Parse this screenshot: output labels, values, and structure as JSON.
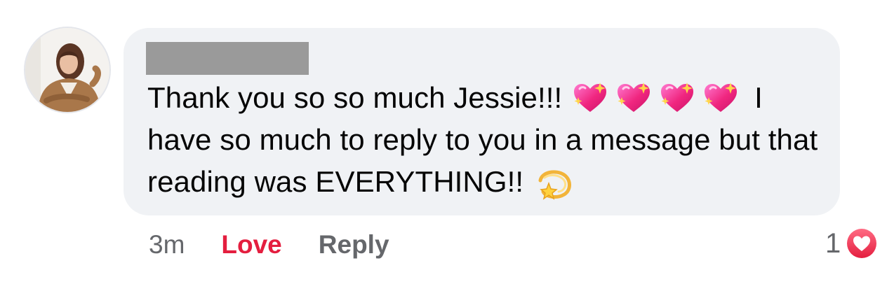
{
  "comment": {
    "text_line1": "Thank you so so much Jessie!!!",
    "text_line1_end": "I",
    "text_rest": "have so much to reply to you in a message but that reading was EVERYTHING!!",
    "emojis": [
      "sparkling-heart",
      "sparkling-heart",
      "sparkling-heart",
      "sparkling-heart",
      "dizzy"
    ]
  },
  "actions": {
    "timestamp": "3m",
    "love_label": "Love",
    "reply_label": "Reply"
  },
  "reactions": {
    "count": "1",
    "type": "love"
  },
  "colors": {
    "bubble_bg": "#f0f2f5",
    "love_red": "#e41e3f",
    "secondary_text": "#65676b",
    "text": "#050505",
    "redaction_gray": "#9a9a9a"
  }
}
